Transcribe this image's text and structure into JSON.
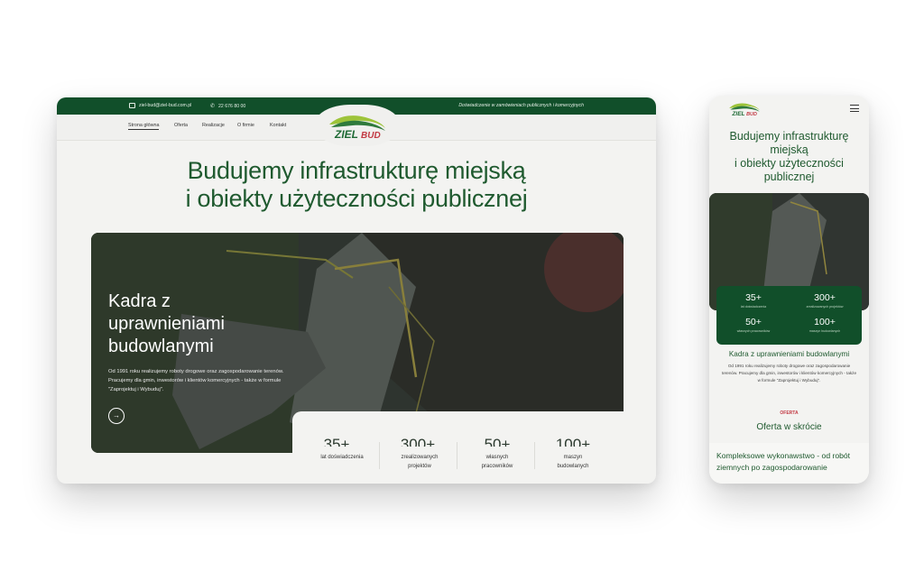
{
  "colors": {
    "brand_green": "#114f2a",
    "heading_green": "#1f5a2f",
    "accent_red": "#c23a44",
    "page_bg": "#f3f3f1"
  },
  "desktop": {
    "topbar": {
      "email": "ziel-bud@ziel-bud.com.pl",
      "phone": "22 676 80 00",
      "tagline": "Doświadczenie w zamówieniach publicznych i komercyjnych",
      "email_icon": "mail-icon",
      "phone_icon": "phone-icon"
    },
    "nav": [
      "Strona główna",
      "Oferta",
      "Realizacje",
      "O firmie",
      "Kontakt"
    ],
    "logo_text": "ZIEL BUD",
    "headline_line1": "Budujemy infrastrukturę miejską",
    "headline_line2": "i obiekty użyteczności publicznej",
    "hero": {
      "title": "Kadra z uprawnieniami budowlanymi",
      "text": "Od 1991 roku realizujemy roboty drogowe oraz zagospodarowanie terenów. Pracujemy dla gmin, inwestorów i klientów komercyjnych - także w formule \"Zaprojektuj i Wybuduj\".",
      "arrow_icon": "arrow-right-icon",
      "arrow": "→"
    },
    "stats": [
      {
        "number": "35+",
        "label_line1": "lat doświadczenia",
        "label_line2": ""
      },
      {
        "number": "300+",
        "label_line1": "zrealizowanych",
        "label_line2": "projektów"
      },
      {
        "number": "50+",
        "label_line1": "własnych",
        "label_line2": "pracowników"
      },
      {
        "number": "100+",
        "label_line1": "maszyn",
        "label_line2": "budowlanych"
      }
    ]
  },
  "mobile": {
    "logo_text": "ZIEL BUD",
    "menu_icon": "hamburger-menu-icon",
    "headline_line1": "Budujemy infrastrukturę",
    "headline_line2": "miejską",
    "headline_line3": "i obiekty użyteczności",
    "headline_line4": "publicznej",
    "stats": [
      {
        "number": "35+",
        "label": "lat doświadczenia"
      },
      {
        "number": "300+",
        "label": "zrealizowanych projektów"
      },
      {
        "number": "50+",
        "label": "własnych pracowników"
      },
      {
        "number": "100+",
        "label": "maszyn budowlanych"
      }
    ],
    "subtitle": "Kadra z uprawnieniami budowlanymi",
    "text": "Od 1991 roku realizujemy roboty drogowe oraz zagospodarowanie terenów. Pracujemy dla gmin, inwestorów i klientów komercyjnych - także w formule \"Zaprojektuj i Wybuduj\".",
    "overline": "OFERTA",
    "offer_title": "Oferta w skrócie",
    "card_title": "Kompleksowe wykonawstwo - od robót ziemnych po zagospodarowanie"
  }
}
